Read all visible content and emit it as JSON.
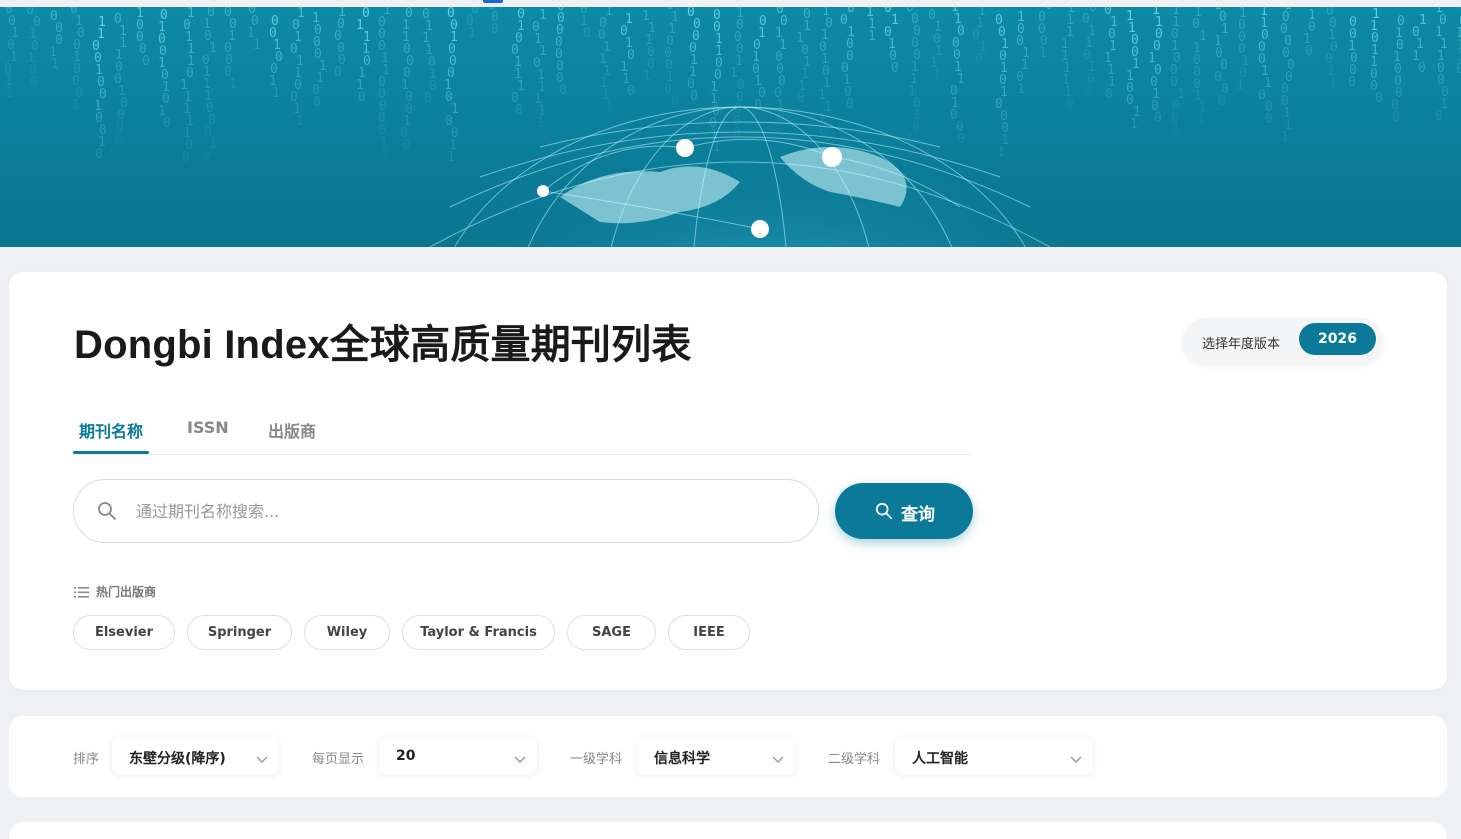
{
  "page": {
    "title": "Dongbi Index全球高质量期刊列表"
  },
  "year_selector": {
    "label": "选择年度版本",
    "value": "2026"
  },
  "tabs": [
    {
      "label": "期刊名称",
      "active": true
    },
    {
      "label": "ISSN",
      "active": false
    },
    {
      "label": "出版商",
      "active": false
    }
  ],
  "search": {
    "placeholder": "通过期刊名称搜索...",
    "value": "",
    "button_label": "查询",
    "icon": "search-icon"
  },
  "hot_publishers": {
    "title": "热门出版商",
    "icon": "list-icon",
    "items": [
      "Elsevier",
      "Springer",
      "Wiley",
      "Taylor & Francis",
      "SAGE",
      "IEEE"
    ]
  },
  "filters": [
    {
      "label": "排序",
      "value": "东壁分级(降序)"
    },
    {
      "label": "每页显示",
      "value": "20"
    },
    {
      "label": "一级学科",
      "value": "信息科学"
    },
    {
      "label": "二级学科",
      "value": "人工智能"
    }
  ],
  "colors": {
    "accent": "#0b7a98",
    "banner": "#0b7f9b",
    "background": "#eef0f4"
  }
}
